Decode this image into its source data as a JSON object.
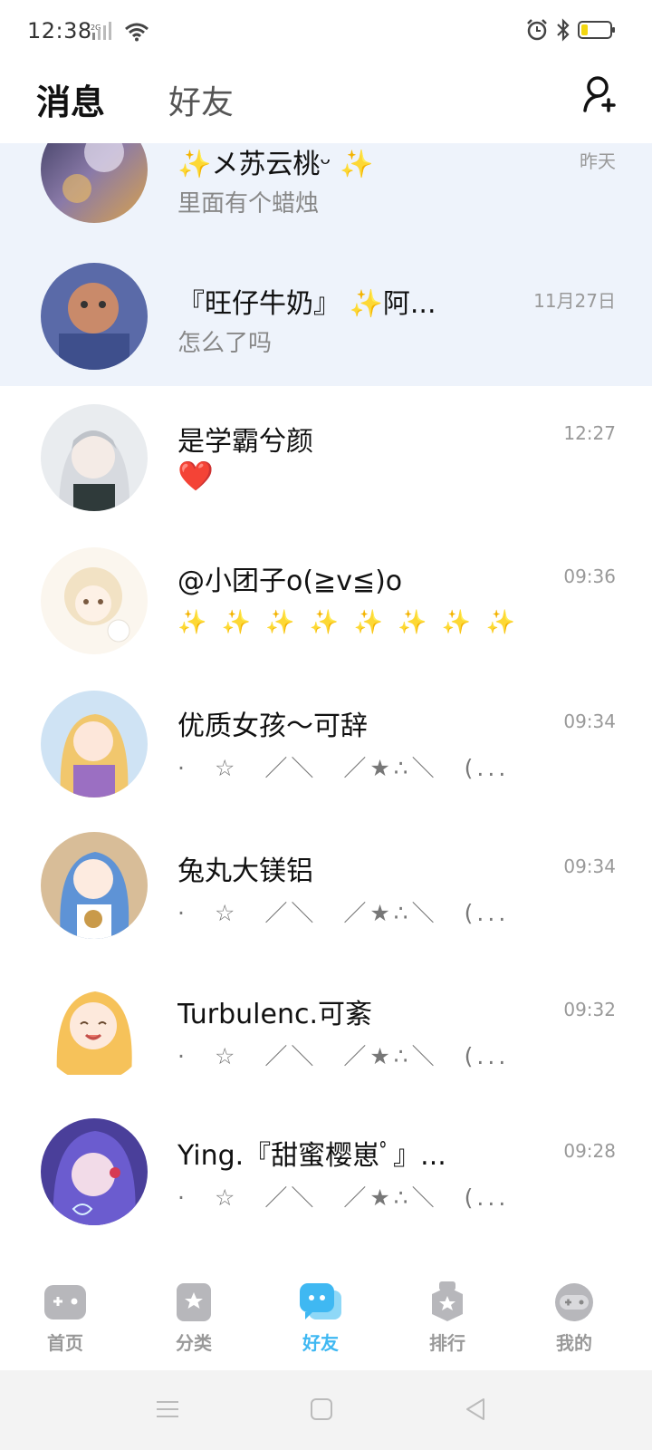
{
  "status_bar": {
    "time": "12:38",
    "network": "2G",
    "icons": [
      "signal-icon",
      "wifi-icon",
      "alarm-icon",
      "bluetooth-icon",
      "battery-icon"
    ],
    "battery_color": "#f2d60f"
  },
  "header": {
    "tab_messages": "消息",
    "tab_friends": "好友",
    "add_friend_icon": "add-user-icon"
  },
  "conversations": [
    {
      "name": "✨メ苏云桃ᵕ ✨",
      "preview": "里面有个蜡烛",
      "time": "昨天",
      "pinned": true
    },
    {
      "name": "『旺仔牛奶』 ✨阿...",
      "preview": "怎么了吗",
      "time": "11月27日",
      "pinned": true
    },
    {
      "name": "是学霸兮颜",
      "preview": "❤️",
      "time": "12:27",
      "pinned": false
    },
    {
      "name": "@小团子o(≧v≦)o",
      "preview": "✨ ✨ ✨ ✨ ✨ ✨ ✨ ✨ ✨ 🌟❤️...",
      "time": "09:36",
      "pinned": false
    },
    {
      "name": "优质女孩～可辞",
      "preview": "·　☆　／＼　／★∴＼　(...",
      "time": "09:34",
      "pinned": false
    },
    {
      "name": "兔丸大镁铝",
      "preview": "·　☆　／＼　／★∴＼　(...",
      "time": "09:34",
      "pinned": false
    },
    {
      "name": "Turbulenc.可紊",
      "preview": "·　☆　／＼　／★∴＼　(...",
      "time": "09:32",
      "pinned": false
    },
    {
      "name": "Ying.『甜蜜樱崽ﾟ』...",
      "preview": "·　☆　／＼　／★∴＼　(...",
      "time": "09:28",
      "pinned": false
    }
  ],
  "bottom_nav": {
    "items": [
      {
        "label": "首页",
        "icon": "gamepad-icon"
      },
      {
        "label": "分类",
        "icon": "category-icon"
      },
      {
        "label": "好友",
        "icon": "chat-icon",
        "active": true
      },
      {
        "label": "排行",
        "icon": "ranking-icon"
      },
      {
        "label": "我的",
        "icon": "profile-icon"
      }
    ],
    "active_color": "#3fb8f2",
    "inactive_color": "#999999"
  },
  "system_nav": {
    "icons": [
      "menu-icon",
      "home-icon",
      "back-icon"
    ]
  }
}
